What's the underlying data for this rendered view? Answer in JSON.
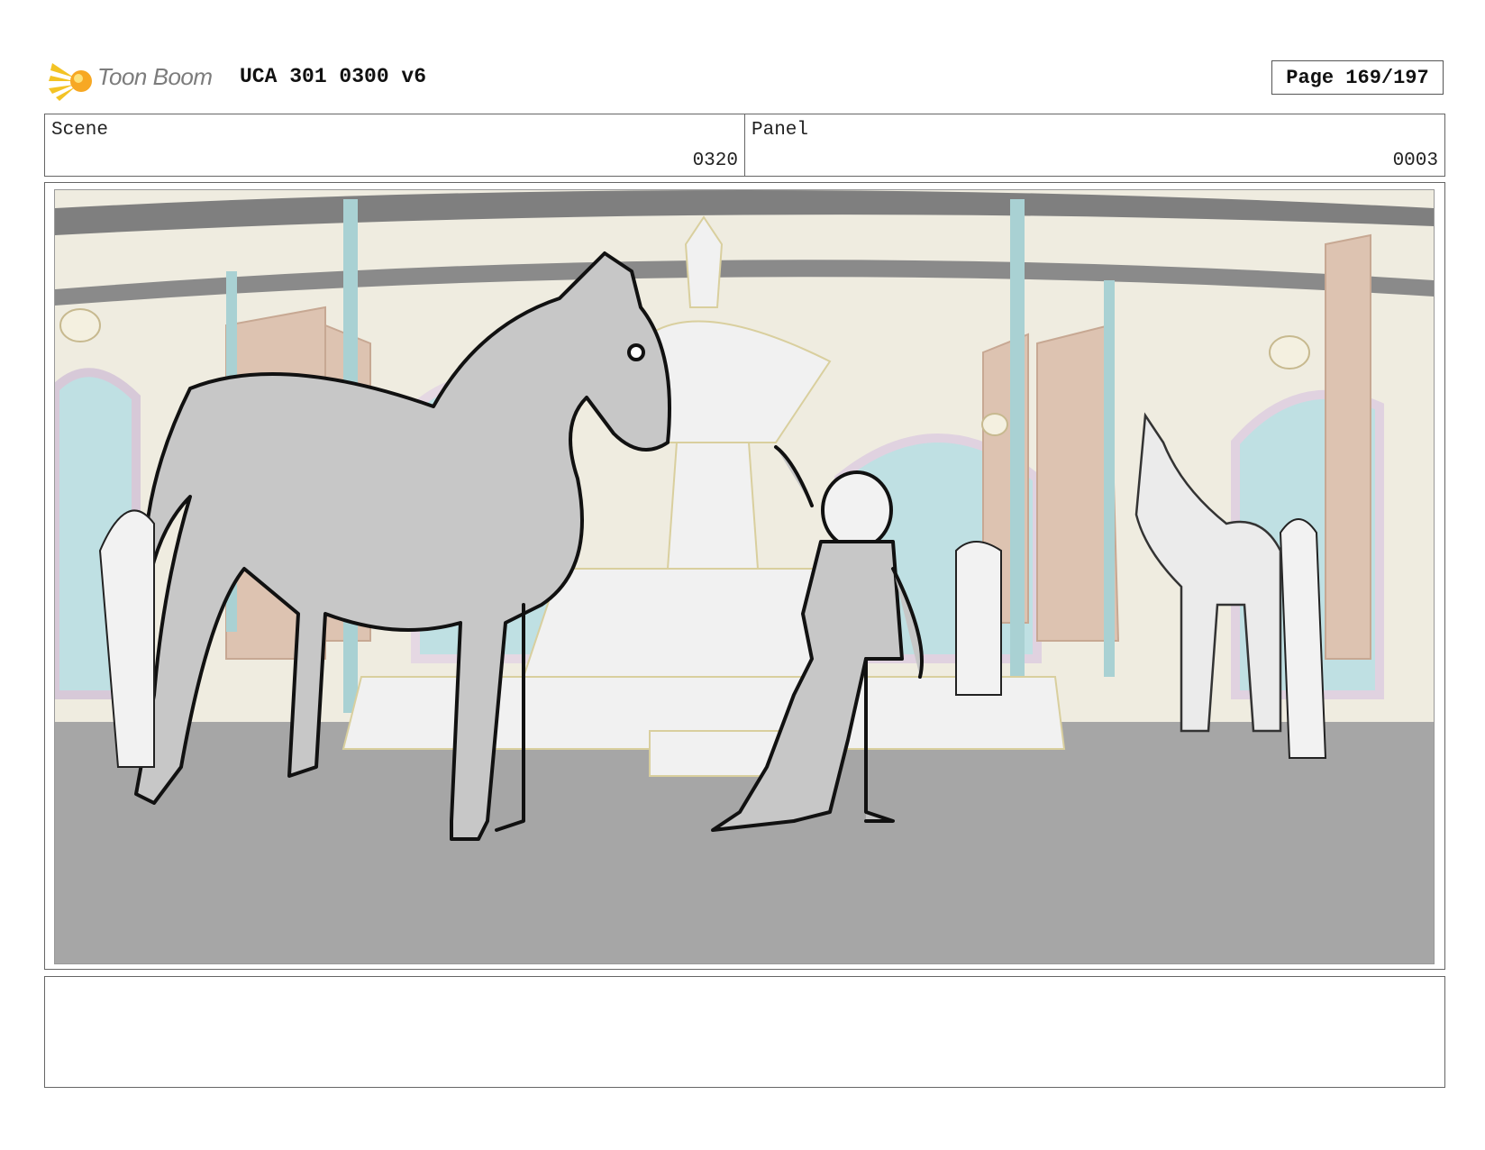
{
  "header": {
    "logo_text": "Toon Boom",
    "title": "UCA 301 0300 v6",
    "page": "Page 169/197"
  },
  "info": {
    "scene_label": "Scene",
    "scene_value": "0320",
    "panel_label": "Panel",
    "panel_value": "0003"
  },
  "notes": {
    "text": ""
  },
  "colors": {
    "wall": "#efece0",
    "floor": "#a6a6a6",
    "teal": "#bfe0e3",
    "pillar": "#a9d1d3",
    "door": "#ddc3b1",
    "horse_fill": "#c7c7c7",
    "gold": "#d9cf9e"
  }
}
